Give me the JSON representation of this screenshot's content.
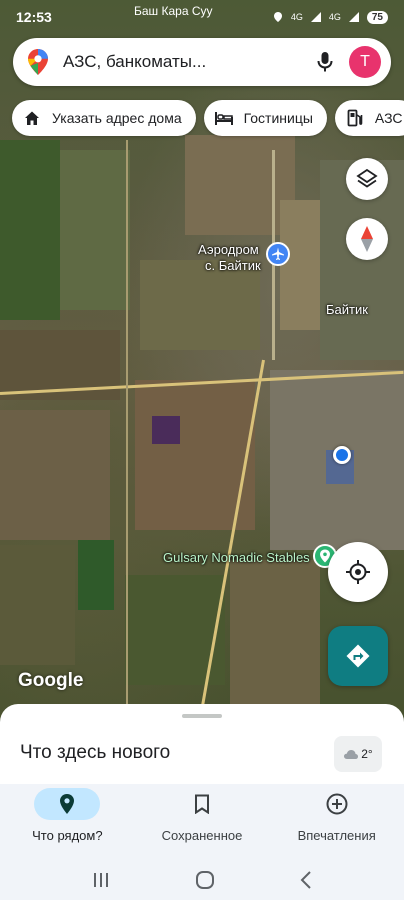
{
  "status_bar": {
    "time": "12:53",
    "place": "Баш Кара Суу",
    "net1": "4G",
    "net2": "4G",
    "battery": "75"
  },
  "search": {
    "placeholder": "АЗС, банкоматы...",
    "avatar_letter": "T"
  },
  "chips": [
    {
      "label": "Указать адрес дома",
      "icon": "home-icon"
    },
    {
      "label": "Гостиницы",
      "icon": "bed-icon"
    },
    {
      "label": "АЗС",
      "icon": "gas-station-icon"
    }
  ],
  "map": {
    "labels": {
      "airport_line1": "Аэродром",
      "airport_line2": "с. Байтик",
      "village": "Байтик",
      "stables": "Gulsary Nomadic Stables"
    },
    "logo": "Google"
  },
  "sheet": {
    "title": "Что здесь нового",
    "temperature": "2°"
  },
  "bottom_nav": [
    {
      "label": "Что рядом?",
      "icon": "location-pin-icon",
      "active": true
    },
    {
      "label": "Сохраненное",
      "icon": "bookmark-icon",
      "active": false
    },
    {
      "label": "Впечатления",
      "icon": "add-circle-icon",
      "active": false
    }
  ],
  "colors": {
    "accent": "#0f7d82",
    "active_tab": "#c2e7ff",
    "avatar": "#e8336d"
  }
}
